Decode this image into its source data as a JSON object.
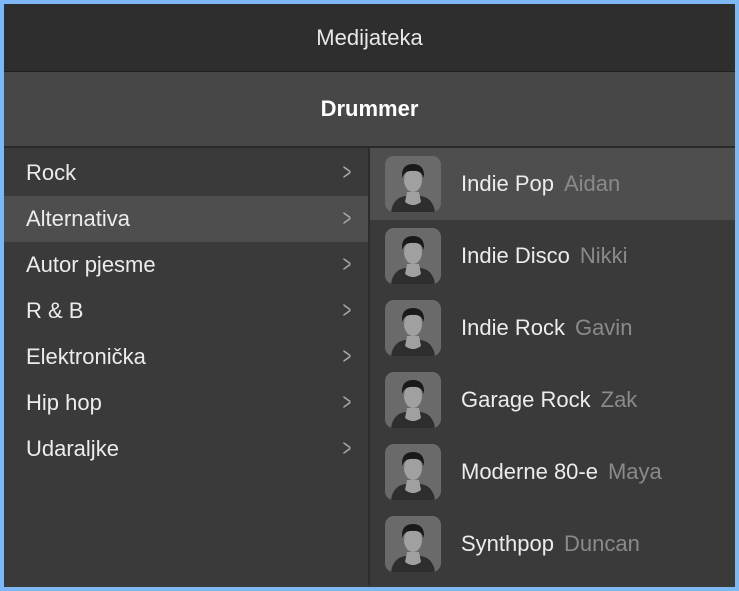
{
  "window": {
    "title": "Medijateka",
    "subtitle": "Drummer"
  },
  "categories": [
    {
      "label": "Rock",
      "selected": false
    },
    {
      "label": "Alternativa",
      "selected": true
    },
    {
      "label": "Autor pjesme",
      "selected": false
    },
    {
      "label": "R & B",
      "selected": false
    },
    {
      "label": "Elektronička",
      "selected": false
    },
    {
      "label": "Hip hop",
      "selected": false
    },
    {
      "label": "Udaraljke",
      "selected": false
    }
  ],
  "drummers": [
    {
      "genre": "Indie Pop",
      "name": "Aidan",
      "selected": true
    },
    {
      "genre": "Indie Disco",
      "name": "Nikki",
      "selected": false
    },
    {
      "genre": "Indie Rock",
      "name": "Gavin",
      "selected": false
    },
    {
      "genre": "Garage Rock",
      "name": "Zak",
      "selected": false
    },
    {
      "genre": "Moderne 80-e",
      "name": "Maya",
      "selected": false
    },
    {
      "genre": "Synthpop",
      "name": "Duncan",
      "selected": false
    }
  ],
  "colors": {
    "border": "#7db8f5",
    "selected_row": "#4e4e4e"
  }
}
